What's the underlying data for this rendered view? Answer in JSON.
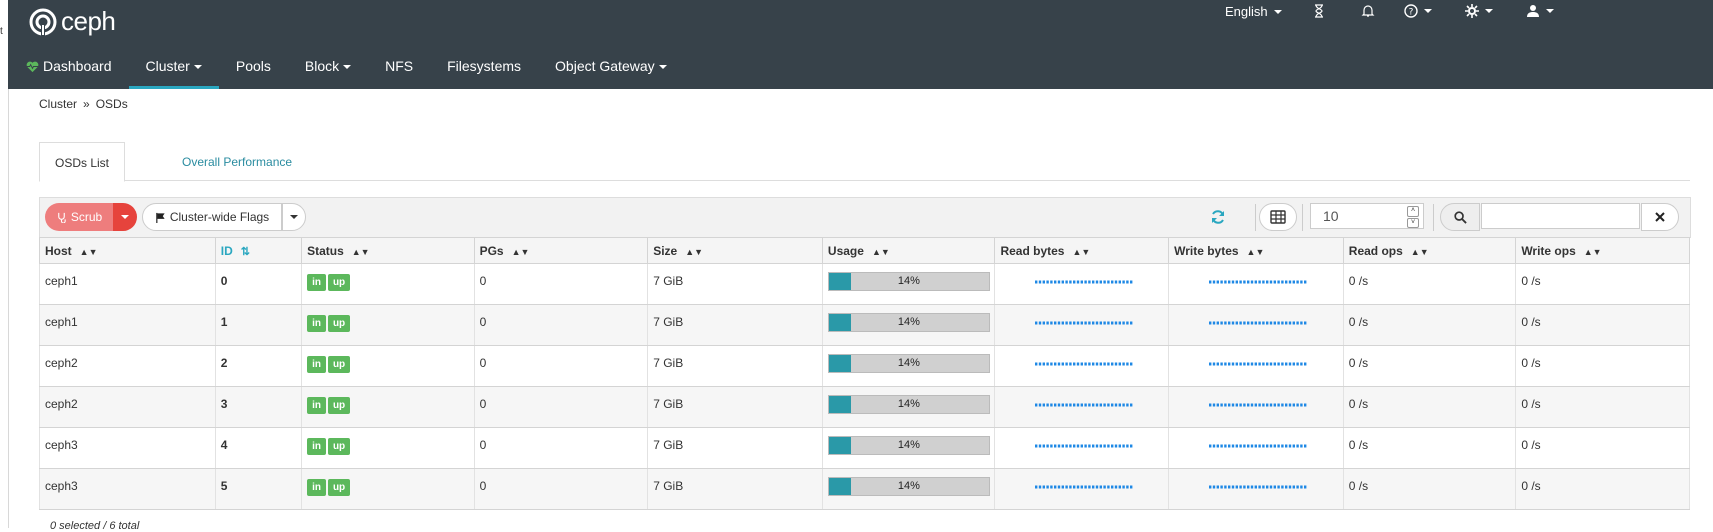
{
  "sidebar": {
    "glyph": "t"
  },
  "brand": {
    "name": "ceph"
  },
  "header": {
    "language": "English",
    "icons": [
      "hourglass-icon",
      "bell-icon",
      "help-icon",
      "gear-icon",
      "user-icon"
    ]
  },
  "nav": {
    "dashboard": "Dashboard",
    "cluster": "Cluster",
    "pools": "Pools",
    "block": "Block",
    "nfs": "NFS",
    "filesystems": "Filesystems",
    "object_gateway": "Object Gateway"
  },
  "breadcrumb": {
    "parent": "Cluster",
    "separator": "»",
    "current": "OSDs"
  },
  "tabs": {
    "list": "OSDs List",
    "performance": "Overall Performance"
  },
  "toolbar": {
    "scrub_label": "Scrub",
    "flags_label": "Cluster-wide Flags",
    "page_size": "10",
    "search_value": ""
  },
  "columns": {
    "host": "Host",
    "id": "ID",
    "status": "Status",
    "pgs": "PGs",
    "size": "Size",
    "usage": "Usage",
    "read_bytes": "Read bytes",
    "write_bytes": "Write bytes",
    "read_ops": "Read ops",
    "write_ops": "Write ops"
  },
  "rows": [
    {
      "host": "ceph1",
      "id": "0",
      "status_in": "in",
      "status_up": "up",
      "pgs": "0",
      "size": "7 GiB",
      "usage_label": "14%",
      "usage": 0.14,
      "read_ops": "0 /s",
      "write_ops": "0 /s"
    },
    {
      "host": "ceph1",
      "id": "1",
      "status_in": "in",
      "status_up": "up",
      "pgs": "0",
      "size": "7 GiB",
      "usage_label": "14%",
      "usage": 0.14,
      "read_ops": "0 /s",
      "write_ops": "0 /s"
    },
    {
      "host": "ceph2",
      "id": "2",
      "status_in": "in",
      "status_up": "up",
      "pgs": "0",
      "size": "7 GiB",
      "usage_label": "14%",
      "usage": 0.14,
      "read_ops": "0 /s",
      "write_ops": "0 /s"
    },
    {
      "host": "ceph2",
      "id": "3",
      "status_in": "in",
      "status_up": "up",
      "pgs": "0",
      "size": "7 GiB",
      "usage_label": "14%",
      "usage": 0.14,
      "read_ops": "0 /s",
      "write_ops": "0 /s"
    },
    {
      "host": "ceph3",
      "id": "4",
      "status_in": "in",
      "status_up": "up",
      "pgs": "0",
      "size": "7 GiB",
      "usage_label": "14%",
      "usage": 0.14,
      "read_ops": "0 /s",
      "write_ops": "0 /s"
    },
    {
      "host": "ceph3",
      "id": "5",
      "status_in": "in",
      "status_up": "up",
      "pgs": "0",
      "size": "7 GiB",
      "usage_label": "14%",
      "usage": 0.14,
      "read_ops": "0 /s",
      "write_ops": "0 /s"
    }
  ],
  "footer": {
    "summary": "0 selected / 6 total"
  },
  "colors": {
    "navbar": "#37424a",
    "accent": "#2aa7c0",
    "badge_green": "#5cb85c",
    "usage_fill": "#2a99a8",
    "scrub_red": "#ee7d7d",
    "sparkline": "#1e88e5"
  }
}
